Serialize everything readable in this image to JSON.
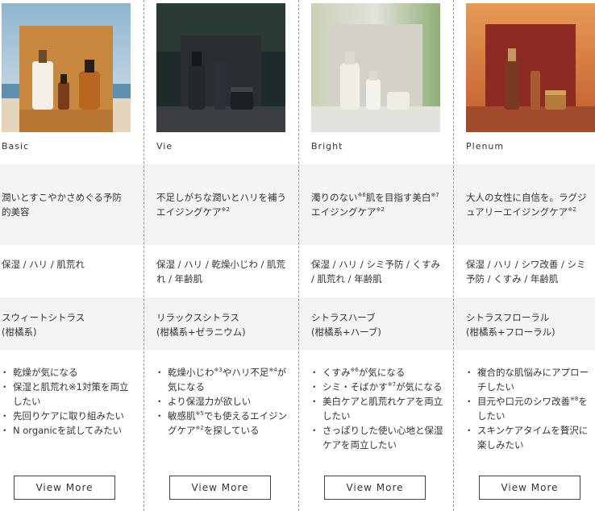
{
  "products": [
    {
      "name": "Basic",
      "concept": "潤いとすこやかさめぐる予防的美容",
      "concerns": "保湿 / ハリ / 肌荒れ",
      "scent": [
        "スウィートシトラス",
        "(柑橘系)"
      ],
      "recommend": [
        "乾燥が気になる",
        "保湿と肌荒れ※1対策を両立したい",
        "先回りケアに取り組みたい",
        "N organicを試してみたい"
      ],
      "button": "View More",
      "image_icon": "skincare-bottles-beach"
    },
    {
      "name": "Vie",
      "concept": "不足しがちな潤いとハリを補うエイジングケア※2",
      "concerns": "保湿 / ハリ / 乾燥小じわ / 肌荒れ / 年齢肌",
      "scent": [
        "リラックスシトラス",
        "(柑橘系+ゼラニウム)"
      ],
      "recommend": [
        "乾燥小じわ※3やハリ不足※4が気になる",
        "より保湿力が欲しい",
        "敏感肌※5でも使えるエイジングケア※2を探している"
      ],
      "button": "View More",
      "image_icon": "skincare-bottles-dark-forest"
    },
    {
      "name": "Bright",
      "concept": "濁りのない※6肌を目指す美白※7エイジングケア※2",
      "concerns": "保湿 / ハリ / シミ予防 / くすみ / 肌荒れ / 年齢肌",
      "scent": [
        "シトラスハーブ",
        "(柑橘系+ハーブ)"
      ],
      "recommend": [
        "くすみ※6が気になる",
        "シミ・そばかす※7が気になる",
        "美白ケアと肌荒れケアを両立したい",
        "さっぱりした使い心地と保湿ケアを両立したい"
      ],
      "button": "View More",
      "image_icon": "skincare-bottles-light-green"
    },
    {
      "name": "Plenum",
      "concept": "大人の女性に自信を。ラグジュアリーエイジングケア※2",
      "concerns": "保湿 / ハリ / シワ改善 / シミ予防 / くすみ / 年齢肌",
      "scent": [
        "シトラスフローラル",
        "(柑橘系+フローラル)"
      ],
      "recommend": [
        "複合的な肌悩みにアプローチしたい",
        "目元や口元のシワ改善※8をしたい",
        "スキンケアタイムを贅沢に楽しみたい"
      ],
      "button": "View More",
      "image_icon": "skincare-bottles-sunset-red"
    }
  ],
  "colors": {
    "band": "#f4f4f2",
    "text": "#333333",
    "divider": "#9a9a9a"
  }
}
